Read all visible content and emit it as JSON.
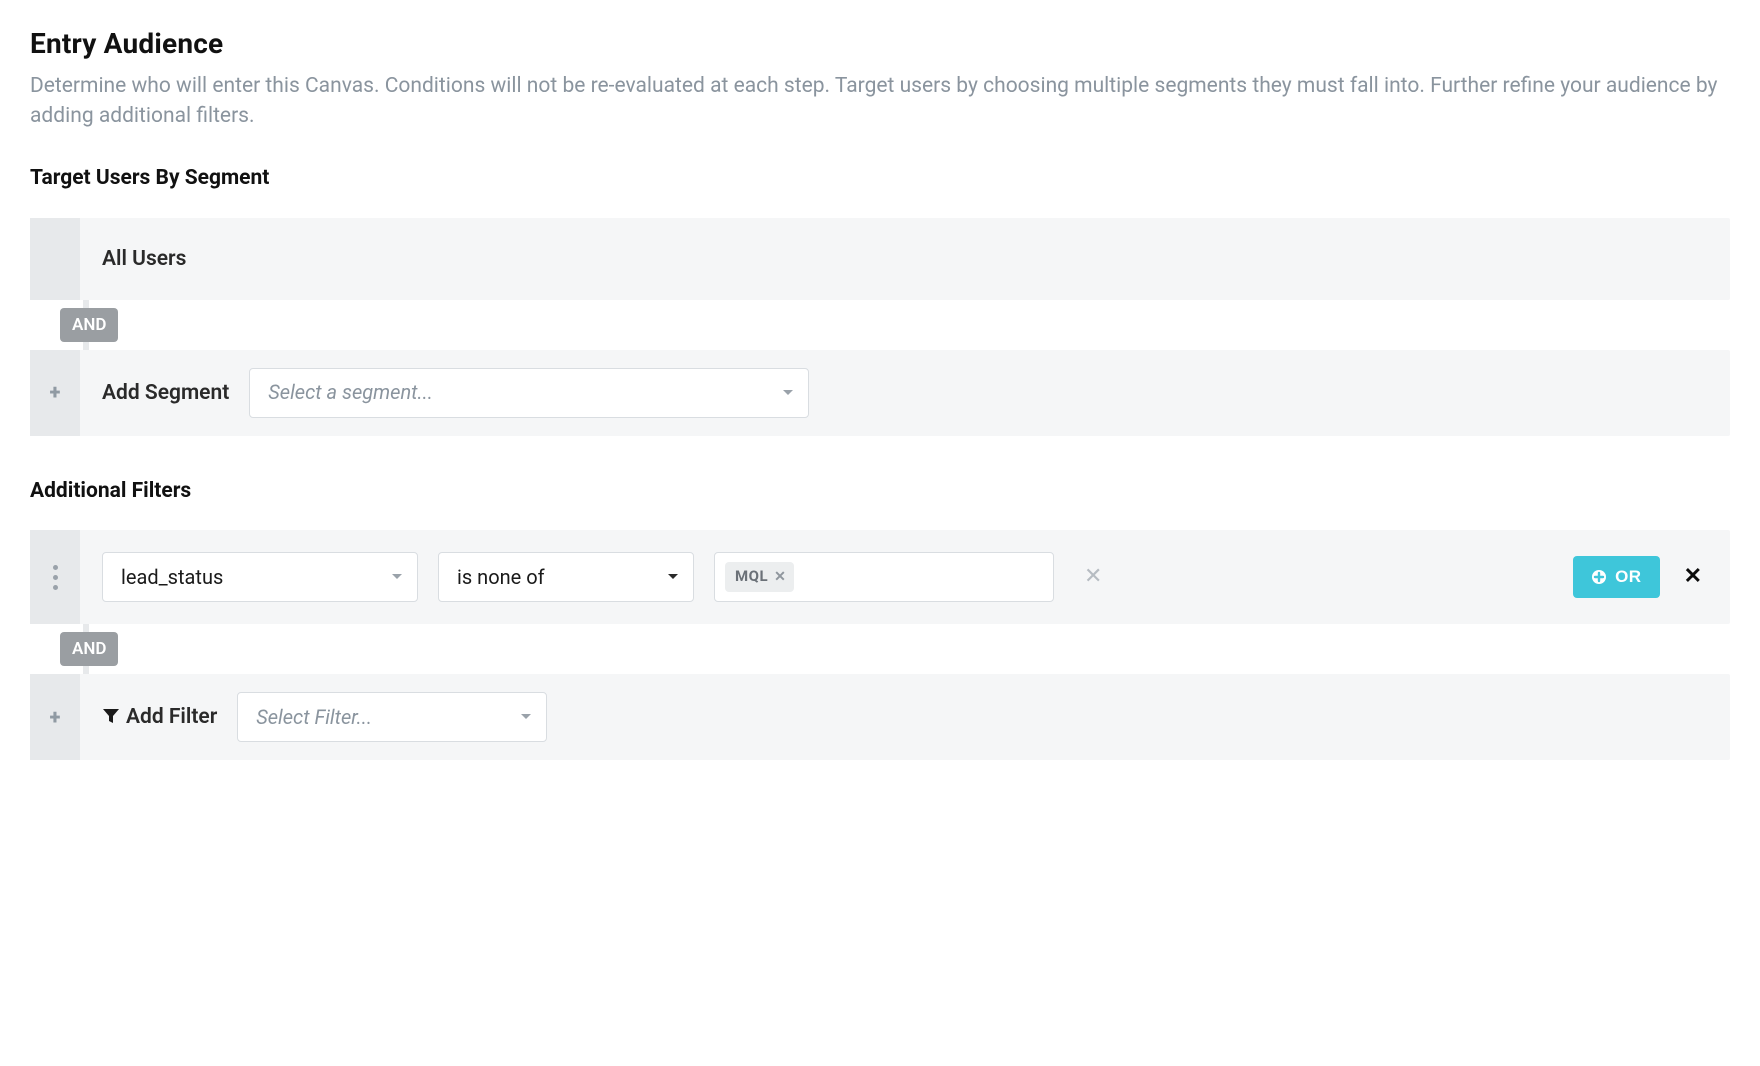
{
  "header": {
    "title": "Entry Audience",
    "description": "Determine who will enter this Canvas. Conditions will not be re-evaluated at each step. Target users by choosing multiple segments they must fall into. Further refine your audience by adding additional filters."
  },
  "segments": {
    "title": "Target Users By Segment",
    "rows": [
      {
        "label": "All Users"
      }
    ],
    "and_label": "AND",
    "add_label": "Add Segment",
    "select_placeholder": "Select a segment..."
  },
  "filters": {
    "title": "Additional Filters",
    "rows": [
      {
        "attribute": "lead_status",
        "operator": "is none of",
        "values": [
          "MQL"
        ]
      }
    ],
    "or_label": "OR",
    "and_label": "AND",
    "add_label": "Add Filter",
    "select_placeholder": "Select Filter..."
  }
}
